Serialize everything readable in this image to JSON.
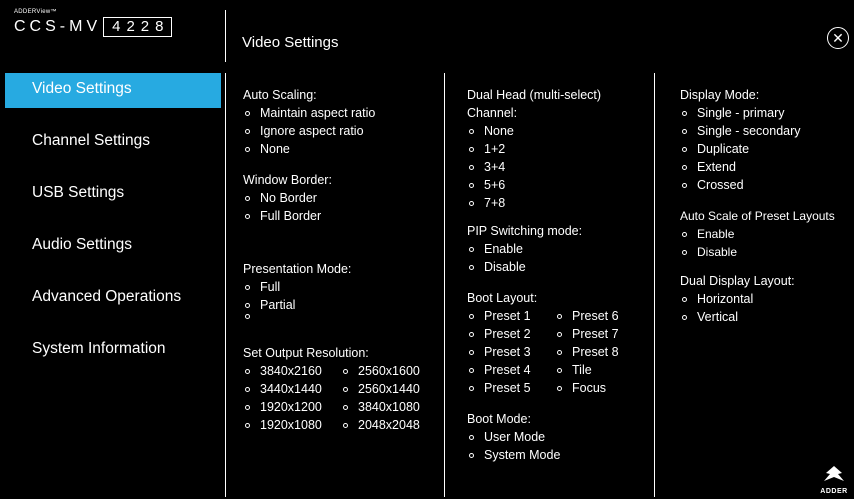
{
  "brand": {
    "small": "ADDERView™",
    "product": "CCS-MV",
    "model": "4228"
  },
  "header": {
    "title": "Video Settings"
  },
  "close_icon": "close-icon",
  "sidebar": {
    "items": [
      {
        "label": "Video Settings",
        "active": true
      },
      {
        "label": "Channel Settings"
      },
      {
        "label": "USB Settings"
      },
      {
        "label": "Audio Settings"
      },
      {
        "label": "Advanced Operations"
      },
      {
        "label": "System Information"
      }
    ],
    "accent": "#27aae1"
  },
  "auto_scaling": {
    "title": "Auto Scaling:",
    "options": [
      "Maintain aspect ratio",
      "Ignore aspect ratio",
      "None"
    ]
  },
  "window_border": {
    "title": "Window Border:",
    "options": [
      "No Border",
      "Full Border"
    ]
  },
  "presentation_mode": {
    "title": "Presentation Mode:",
    "options": [
      "Full",
      "Partial",
      ""
    ]
  },
  "output_resolution": {
    "title": "Set Output Resolution:",
    "options": [
      "3840x2160",
      "2560x1600",
      "3440x1440",
      "2560x1440",
      "1920x1200",
      "3840x1080",
      "1920x1080",
      "2048x2048"
    ]
  },
  "dual_head": {
    "title_line1": "Dual Head (multi-select)",
    "title_line2": "Channel:",
    "options": [
      "None",
      "1+2",
      "3+4",
      "5+6",
      "7+8"
    ]
  },
  "pip_switching": {
    "title": "PIP Switching mode:",
    "options": [
      "Enable",
      "Disable"
    ]
  },
  "boot_layout": {
    "title": "Boot Layout:",
    "options": [
      "Preset 1",
      "Preset 6",
      "Preset 2",
      "Preset 7",
      "Preset 3",
      "Preset 8",
      "Preset 4",
      "Tile",
      "Preset 5",
      "Focus"
    ]
  },
  "boot_mode": {
    "title": "Boot Mode:",
    "options": [
      "User Mode",
      "System Mode"
    ]
  },
  "display_mode": {
    "title": "Display Mode:",
    "options": [
      "Single - primary",
      "Single - secondary",
      "Duplicate",
      "Extend",
      "Crossed"
    ]
  },
  "auto_scale_presets": {
    "title": "Auto Scale of Preset Layouts",
    "options": [
      "Enable",
      "Disable"
    ]
  },
  "dual_display_layout": {
    "title": "Dual Display Layout:",
    "options": [
      "Horizontal",
      "Vertical"
    ]
  },
  "logo": {
    "text": "ADDER"
  }
}
